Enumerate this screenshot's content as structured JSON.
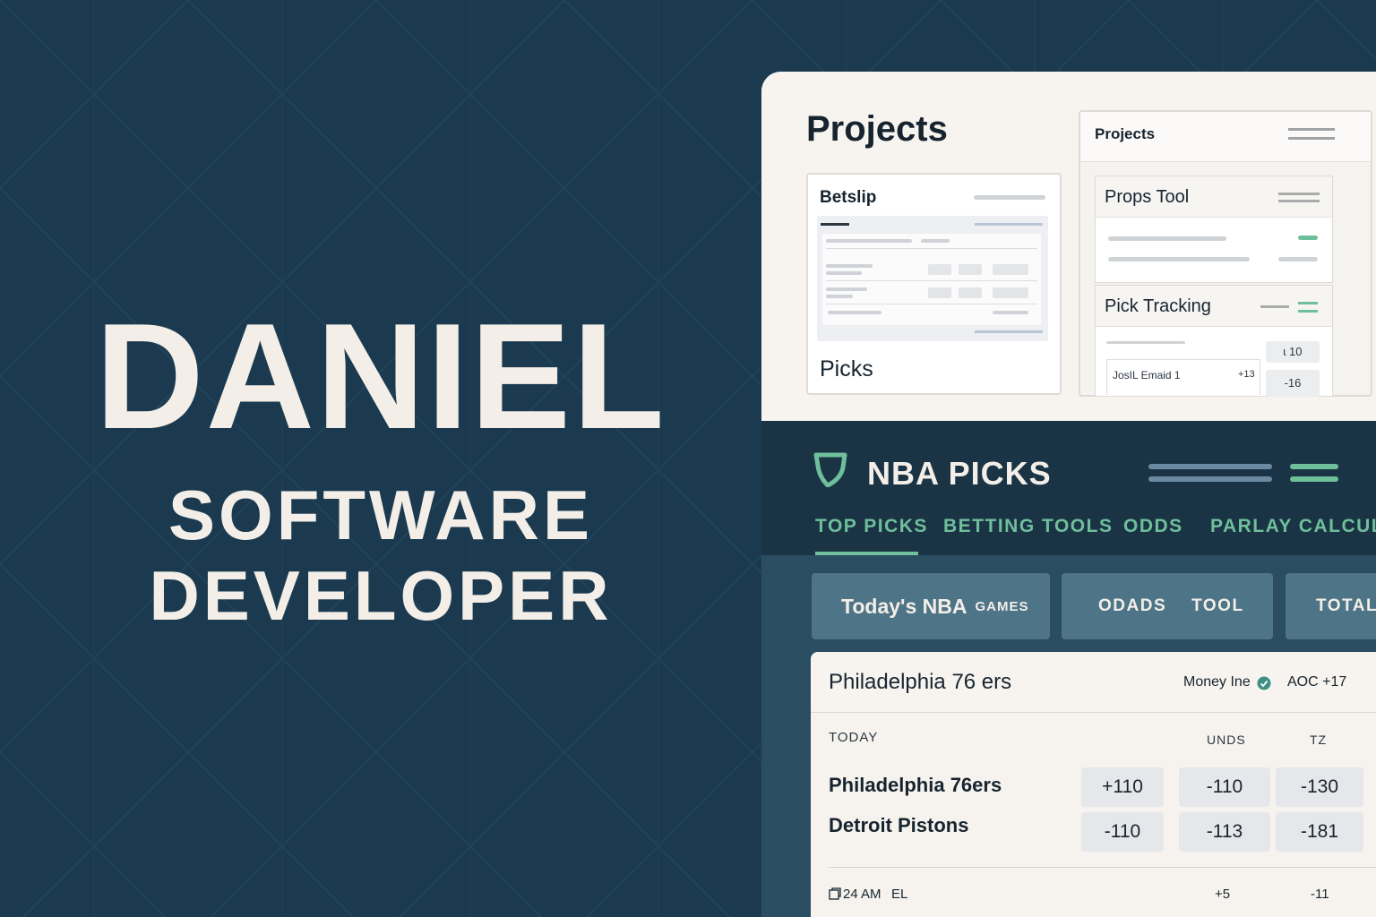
{
  "hero": {
    "name": "DANIEL",
    "role_line1": "SOFTWARE",
    "role_line2": "DEVELOPER"
  },
  "projects": {
    "title": "Projects",
    "betslip": {
      "title": "Betslip",
      "footer": "Picks"
    },
    "panel": {
      "title": "Projects",
      "props_tool": {
        "title": "Props Tool"
      },
      "pick_tracking": {
        "title": "Pick Tracking",
        "row_label": "JosIL Emaid 1",
        "row_delta": "+13",
        "chip_top": "ɩ 10",
        "chip_bottom": "-16"
      }
    }
  },
  "nba": {
    "title": "NBA PICKS",
    "tabs": [
      "TOP PICKS",
      "BETTING TOOLS",
      "ODDS",
      "PARLAY CALCULA"
    ],
    "active_tab": "TOP PICKS",
    "pills": {
      "games_main": "Today's NBA",
      "games_small": "GAMES",
      "odds_a": "ODADS",
      "odds_b": "TOOL",
      "total": "TOTAL"
    },
    "game": {
      "title": "Philadelphia 76 ers",
      "money_line": "Money Ine",
      "aoc": "AOC +17",
      "day": "TODAY",
      "col2": "UNDS",
      "col3": "TZ",
      "teams": [
        {
          "name": "Philadelphia 76ers",
          "odds": [
            "+110",
            "-110",
            "-130"
          ]
        },
        {
          "name": "Detroit Pistons",
          "odds": [
            "-110",
            "-113",
            "-181"
          ]
        }
      ],
      "footer_time": "24 AM",
      "footer_code": "EL",
      "footer_a": "+5",
      "footer_b": "-11"
    }
  },
  "colors": {
    "background": "#1c3a4f",
    "accent": "#6fbf9b",
    "hero_text": "#f3efe8",
    "nav_dark": "#1b3445",
    "pill": "#4e7488"
  },
  "icons": {
    "logo": "shield-logo-icon",
    "check": "check-circle-icon",
    "clock": "clock-icon"
  }
}
